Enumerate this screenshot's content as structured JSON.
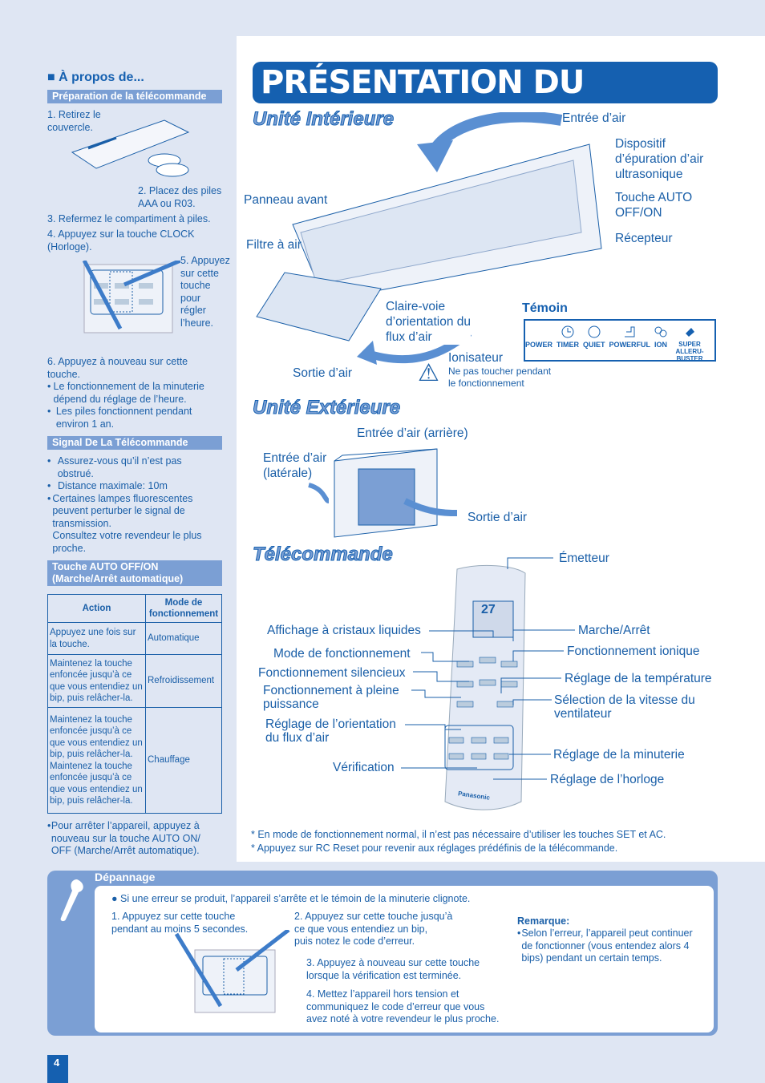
{
  "page_number": "4",
  "left": {
    "heading": "■ À propos de...",
    "prep": {
      "title": "Préparation de la télécommande",
      "steps": [
        "1. Retirez le\n    couvercle.",
        "2. Placez des piles\n    AAA ou R03.",
        "3. Refermez le compartiment à piles.",
        "4. Appuyez sur la touche CLOCK\n    (Horloge).",
        "5. Appuyez\n    sur cette\n    touche\n    pour\n    régler\n    l’heure.",
        "6. Appuyez à nouveau sur cette\n    touche."
      ],
      "bullets": [
        "Le fonctionnement de la minuterie dépend du réglage de l’heure.",
        "Les piles fonctionnent pendant environ 1 an."
      ]
    },
    "signal": {
      "title": "Signal De La Télécommande",
      "bullets": [
        "Assurez-vous qu’il n’est pas obstrué.",
        "Distance maximale: 10m",
        "Certaines lampes fluorescentes peuvent perturber le signal de transmission.\nConsultez votre revendeur le plus proche."
      ]
    },
    "auto": {
      "title": "Touche AUTO OFF/ON\n(Marche/Arrêt automatique)",
      "table": {
        "headers": [
          "Action",
          "Mode de fonctionnement"
        ],
        "rows": [
          [
            "Appuyez une fois sur la touche.",
            "Automatique"
          ],
          [
            "Maintenez la touche enfoncée jusqu’à ce que vous entendiez un bip, puis relâcher-la.",
            "Refroidissement"
          ],
          [
            "Maintenez la touche enfoncée jusqu’à ce que vous entendiez un bip, puis relâcher-la.\nMaintenez la touche enfoncée jusqu’à ce que vous entendiez un bip, puis relâcher-la.",
            "Chauffage"
          ]
        ]
      },
      "note": "Pour arrêter l’appareil, appuyez à nouveau sur la touche AUTO ON/ OFF (Marche/Arrêt automatique)."
    }
  },
  "main": {
    "title": "PRÉSENTATION DU PRODUIT",
    "indoor": {
      "title": "Unité Intérieure",
      "labels": {
        "air_in": "Entrée d’air",
        "purifier": "Dispositif\nd’épuration d’air\nultrasonique",
        "auto_btn": "Touche AUTO\nOFF/ON",
        "receiver": "Récepteur",
        "front_panel": "Panneau avant",
        "filter": "Filtre à air",
        "vane": "Claire-voie\nd’orientation du\nflux d’air",
        "ionizer": "Ionisateur",
        "warning": "Ne pas toucher pendant\nle fonctionnement",
        "air_out": "Sortie d’air"
      },
      "indicator": {
        "title": "Témoin",
        "items": [
          "POWER",
          "TIMER",
          "QUIET",
          "POWERFUL",
          "ION",
          "SUPER\nALLERU-BUSTER"
        ]
      }
    },
    "outdoor": {
      "title": "Unité Extérieure",
      "labels": {
        "air_in_back": "Entrée d’air (arrière)",
        "air_in_side": "Entrée d’air\n(latérale)",
        "air_out": "Sortie d’air"
      }
    },
    "remote": {
      "title": "Télécommande",
      "left_labels": [
        "Affichage à cristaux liquides",
        "Mode de fonctionnement",
        "Fonctionnement silencieux",
        "Fonctionnement à pleine\npuissance",
        "Réglage de l’orientation\ndu flux d’air",
        "Vérification"
      ],
      "right_labels": [
        "Émetteur",
        "Marche/Arrêt",
        "Fonctionnement ionique",
        "Réglage de la température",
        "Sélection de la vitesse du\nventilateur",
        "Réglage de la minuterie",
        "Réglage de l’horloge"
      ],
      "display_temp": "27",
      "brand": "Panasonic"
    },
    "footnotes": [
      "*  En mode de fonctionnement normal, il n’est pas nécessaire d’utiliser les touches SET et AC.",
      "*  Appuyez sur RC Reset pour revenir aux réglages prédéfinis de la télécommande."
    ]
  },
  "troubleshoot": {
    "title": "Dépannage",
    "intro": "●  Si une erreur se produit, l’appareil s’arrête et le témoin de la minuterie clignote.",
    "steps": [
      "1. Appuyez sur cette touche\n    pendant au moins 5 secondes.",
      "2. Appuyez sur cette touche jusqu’à\n    ce que vous entendiez un bip,\n    puis notez le code d’erreur.",
      "3. Appuyez à nouveau sur cette touche\n    lorsque la vérification est terminée.",
      "4. Mettez l’appareil hors tension et\n    communiquez le code d’erreur que vous\n    avez noté à votre revendeur le plus proche."
    ],
    "remark_title": "Remarque:",
    "remark": "Selon l’erreur, l’appareil peut continuer de fonctionner (vous entendez alors 4 bips) pendant un certain temps."
  },
  "colors": {
    "text": "#1a5fa8",
    "bar": "#7b9fd4",
    "title_bg": "#1560b0",
    "page_bg": "#dfe6f3"
  }
}
